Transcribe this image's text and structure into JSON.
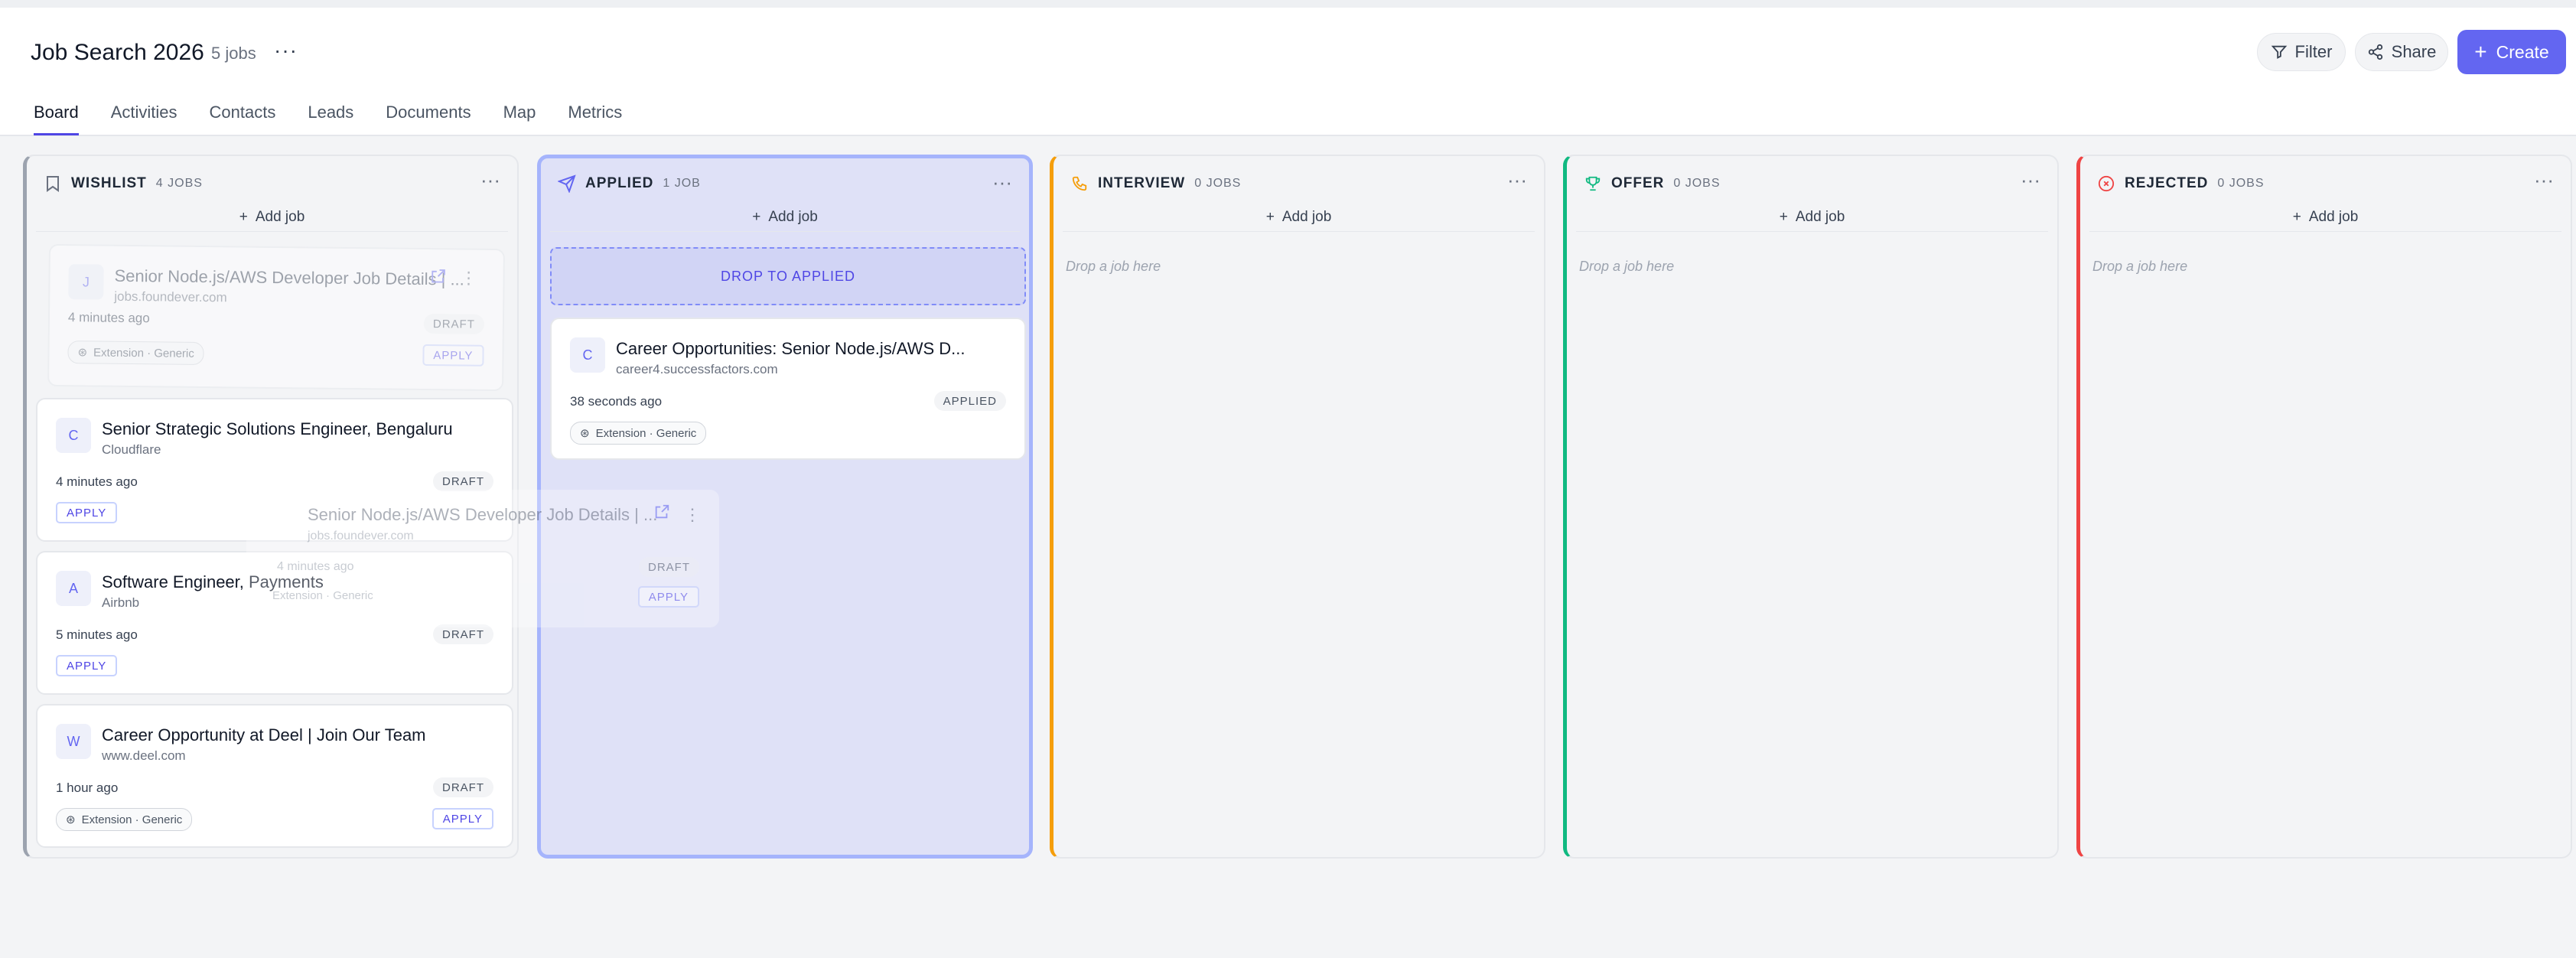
{
  "header": {
    "title": "Job Search 2026",
    "job_count": "5 jobs",
    "more": "···",
    "filter_label": "Filter",
    "share_label": "Share",
    "create_label": "Create"
  },
  "tabs": [
    {
      "label": "Board"
    },
    {
      "label": "Activities"
    },
    {
      "label": "Contacts"
    },
    {
      "label": "Leads"
    },
    {
      "label": "Documents"
    },
    {
      "label": "Map"
    },
    {
      "label": "Metrics"
    }
  ],
  "columns": {
    "wishlist": {
      "name": "WISHLIST",
      "count": "4 JOBS",
      "add": "Add job",
      "accent": "#9ca3af"
    },
    "applied": {
      "name": "APPLIED",
      "count": "1 JOB",
      "add": "Add job",
      "drop": "DROP TO APPLIED",
      "accent": "#6366f1"
    },
    "interview": {
      "name": "INTERVIEW",
      "count": "0 JOBS",
      "add": "Add job",
      "placeholder": "Drop a job here",
      "accent": "#f59e0b"
    },
    "offer": {
      "name": "OFFER",
      "count": "0 JOBS",
      "add": "Add job",
      "placeholder": "Drop a job here",
      "accent": "#10b981"
    },
    "rejected": {
      "name": "REJECTED",
      "count": "0 JOBS",
      "add": "Add job",
      "placeholder": "Drop a job here",
      "accent": "#ef4444"
    }
  },
  "cards": {
    "ghost": {
      "initial": "J",
      "title": "Senior Node.js/AWS Developer Job Details | ...",
      "company": "jobs.foundever.com",
      "time": "4 minutes ago",
      "status": "DRAFT",
      "apply": "APPLY",
      "source": "Extension · Generic"
    },
    "c1": {
      "initial": "C",
      "title": "Senior Strategic Solutions Engineer, Bengaluru",
      "company": "Cloudflare",
      "time": "4 minutes ago",
      "status": "DRAFT",
      "apply": "APPLY"
    },
    "c2": {
      "initial": "A",
      "title": "Software Engineer, Payments",
      "company": "Airbnb",
      "time": "5 minutes ago",
      "status": "DRAFT",
      "apply": "APPLY"
    },
    "c3": {
      "initial": "W",
      "title": "Career Opportunity at Deel | Join Our Team",
      "company": "www.deel.com",
      "time": "1 hour ago",
      "status": "DRAFT",
      "apply": "APPLY",
      "source": "Extension · Generic"
    },
    "applied1": {
      "initial": "C",
      "title": "Career Opportunities: Senior Node.js/AWS D...",
      "company": "career4.successfactors.com",
      "time": "38 seconds ago",
      "status": "APPLIED",
      "source": "Extension · Generic"
    },
    "dragging": {
      "title": "Senior Node.js/AWS Developer Job Details | ...",
      "company": "jobs.foundever.com",
      "time": "4 minutes ago",
      "status": "DRAFT",
      "apply": "APPLY",
      "source": "Extension · Generic"
    }
  }
}
